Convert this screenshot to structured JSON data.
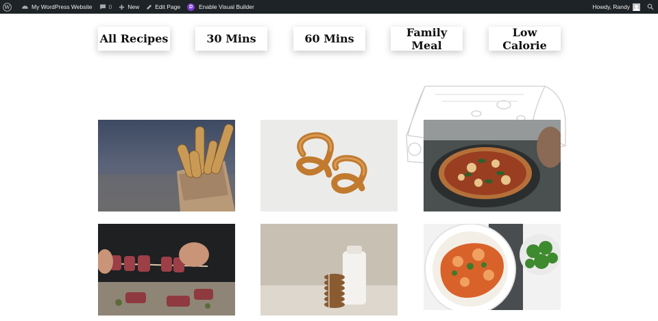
{
  "admin_bar": {
    "site_name": "My WordPress Website",
    "comments_count": "0",
    "new_label": "New",
    "edit_page_label": "Edit Page",
    "visual_builder_label": "Enable Visual Builder",
    "greeting": "Howdy, Randy",
    "icons": [
      "wordpress-icon",
      "dashboard-icon",
      "comment-icon",
      "plus-icon",
      "pencil-icon",
      "divi-icon",
      "avatar",
      "search-icon"
    ]
  },
  "filters": [
    {
      "label": "All Recipes"
    },
    {
      "label": "30 Mins"
    },
    {
      "label": "60 Mins"
    },
    {
      "label": "Family Meal"
    },
    {
      "label": "Low Calorie"
    }
  ],
  "recipes": [
    {
      "image": "breadsticks-in-paper-bag"
    },
    {
      "image": "soft-pretzels"
    },
    {
      "image": "pizza-on-pan"
    },
    {
      "image": "meat-skewers"
    },
    {
      "image": "cookies-and-milk"
    },
    {
      "image": "curry-with-rice"
    }
  ],
  "colors": {
    "admin_bar_bg": "#1d2327",
    "admin_text": "#f0f0f1",
    "divi_purple": "#7e3bd0",
    "page_bg": "#ffffff"
  }
}
